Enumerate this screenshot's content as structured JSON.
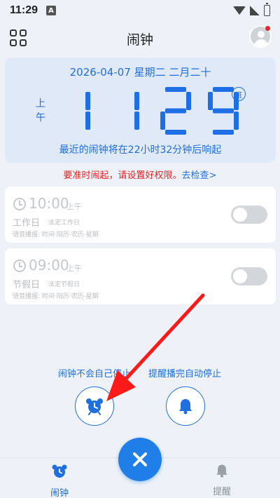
{
  "status_bar": {
    "time": "11:29",
    "notif_icon": "A"
  },
  "header": {
    "title": "闹钟"
  },
  "clock": {
    "date_line": "2026-04-07 星期二 二月二十",
    "ampm": "上午",
    "digits": "1129",
    "ban_badge": "班",
    "next_alarm": "最近的闹钟将在22小时32分钟后响起"
  },
  "permission": {
    "warning": "要准时闹起，请设置好权限。",
    "link": "去检查>"
  },
  "alarms": [
    {
      "time": "10:00",
      "ampm": "上午",
      "day": "工作日",
      "sub": "法定工作日",
      "voice": "语音播报: 时间·阳历·农历·星期"
    },
    {
      "time": "09:00",
      "ampm": "上午",
      "day": "节假日",
      "sub": "法定节假日",
      "voice": "语音播报: 时间·阳历·农历·星期"
    }
  ],
  "modes": {
    "left_label": "闹钟不会自己停止",
    "right_label": "提醒播完自动停止"
  },
  "tabs": {
    "alarm": "闹钟",
    "remind": "提醒"
  },
  "colors": {
    "accent": "#1f6fe0",
    "warning": "#e42525",
    "annotation": "#ff1a1a"
  }
}
